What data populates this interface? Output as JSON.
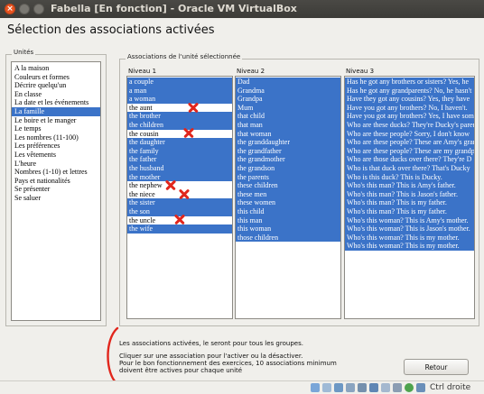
{
  "window": {
    "title": "Fabella [En fonction] - Oracle VM VirtualBox"
  },
  "page": {
    "title": "Sélection des associations activées"
  },
  "units": {
    "legend": "Unités",
    "items": [
      "A la maison",
      "Couleurs et formes",
      "Décrire quelqu'un",
      "En classe",
      "La date et les événements",
      "La famille",
      "Le boire et le manger",
      "Le temps",
      "Les nombres (11-100)",
      "Les préférences",
      "Les vêtements",
      "L'heure",
      "Nombres (1-10) et lettres",
      "Pays et nationalités",
      "Se présenter",
      "Se saluer"
    ],
    "selected_index": 5
  },
  "associations": {
    "legend": "Associations de l'unité sélectionnée",
    "columns": [
      {
        "header": "Niveau 1",
        "rows": [
          "a couple",
          "a man",
          "a woman",
          "the aunt",
          "the brother",
          "the children",
          "the cousin",
          "the daughter",
          "the family",
          "the father",
          "the husband",
          "the mother",
          "the nephew",
          "the niece",
          "the sister",
          "the son",
          "the uncle",
          "the wife"
        ],
        "active": [
          true,
          true,
          true,
          false,
          true,
          true,
          false,
          true,
          true,
          true,
          true,
          true,
          false,
          false,
          true,
          true,
          false,
          true
        ]
      },
      {
        "header": "Niveau 2",
        "rows": [
          "Dad",
          "Grandma",
          "Grandpa",
          "Mum",
          "that child",
          "that man",
          "that woman",
          "the granddaughter",
          "the grandfather",
          "the grandmother",
          "the grandson",
          "the parents",
          "these children",
          "these men",
          "these women",
          "this child",
          "this man",
          "this woman",
          "those children"
        ],
        "active": [
          true,
          true,
          true,
          true,
          true,
          true,
          true,
          true,
          true,
          true,
          true,
          true,
          true,
          true,
          true,
          true,
          true,
          true,
          true
        ]
      },
      {
        "header": "Niveau 3",
        "rows": [
          "Has he got any brothers or sisters?  Yes, he",
          "Has he got any grandparents?   No, he hasn't",
          "Have they got any cousins?  Yes, they have",
          "Have you got any brothers?  No, I haven't.",
          "Have you got any brothers?  Yes, I have some",
          "Who are these ducks?  They're Ducky's parents",
          "Who are these people?  Sorry, I don't know",
          "Who are these people?  These are Amy's grand",
          "Who are these people?  These are my grandpa",
          "Who are those ducks over there?  They're D",
          "Who is that duck over there?  That's Ducky",
          "Who is this duck?  This is Ducky.",
          "Who's this man?  This is Amy's father.",
          "Who's this man?  This is Jason's father.",
          "Who's this man?  This is my father.",
          "Who's this man?  This is my father.",
          "Who's this woman?  This is Amy's mother.",
          "Who's this woman?  This is Jason's mother.",
          "Who's this woman?  This is my mother.",
          "Who's this woman?  This is my mother."
        ],
        "active": [
          true,
          true,
          true,
          true,
          true,
          true,
          true,
          true,
          true,
          true,
          true,
          true,
          true,
          true,
          true,
          true,
          true,
          true,
          true,
          true
        ]
      }
    ]
  },
  "notes": {
    "line1": "Les associations activées, le seront pour tous les groupes.",
    "line2": "Cliquer sur une association pour l'activer ou la désactiver.",
    "line3": "Pour le bon fonctionnement des exercices, 10 associations minimum",
    "line4": "doivent être actives pour chaque unité"
  },
  "buttons": {
    "retour": "Retour"
  },
  "statusbar": {
    "host_key": "Ctrl droite"
  },
  "colors": {
    "selected": "#3b73c8",
    "annotation": "#e1261c"
  }
}
